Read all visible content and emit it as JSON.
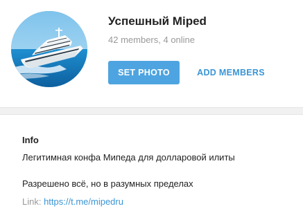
{
  "group": {
    "title": "Успешный Miped",
    "subtitle": "42 members, 4 online"
  },
  "actions": {
    "set_photo_label": "SET PHOTO",
    "add_members_label": "ADD MEMBERS"
  },
  "info": {
    "heading": "Info",
    "description_line1": "Легитимная конфа Мипеда для долларовой илиты",
    "description_line2": "Разрешено всё, но в разумных пределах",
    "link_label": "Link: ",
    "link_url": "https://t.me/mipedru"
  },
  "colors": {
    "accent": "#4ea4e0",
    "link": "#3a95d5",
    "muted_text": "#999999",
    "text": "#222222",
    "divider": "#f1f1f1"
  },
  "icons": {
    "avatar": "yacht-photo"
  }
}
